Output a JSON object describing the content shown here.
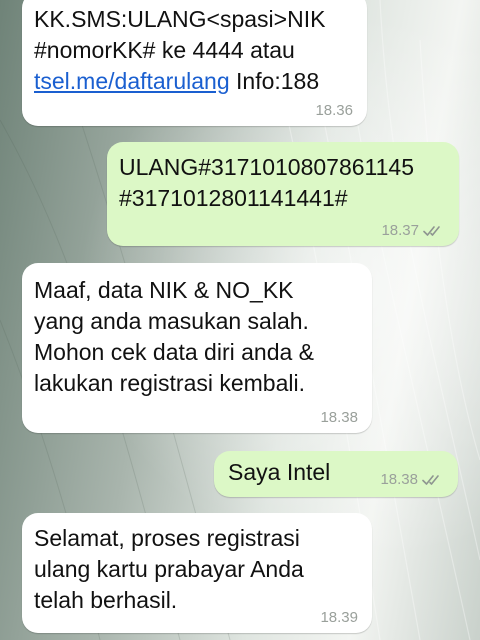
{
  "messages": [
    {
      "direction": "incoming",
      "text_prefix": "KK.SMS:ULANG<spasi>NIK\n#nomorKK# ke 4444 atau\n",
      "link": "tsel.me/daftarulang",
      "text_suffix": " Info:188",
      "time": "18.36"
    },
    {
      "direction": "outgoing",
      "text": "ULANG#3171010807861145\n#3171012801141441#",
      "time": "18.37",
      "status": "read"
    },
    {
      "direction": "incoming",
      "text": "Maaf, data NIK & NO_KK\nyang anda masukan salah.\nMohon cek data diri anda &\nlakukan registrasi kembali.",
      "time": "18.38"
    },
    {
      "direction": "outgoing",
      "text": "Saya Intel",
      "time": "18.38",
      "status": "read"
    },
    {
      "direction": "incoming",
      "text": "Selamat, proses registrasi\nulang kartu prabayar Anda\ntelah berhasil.",
      "time": "18.39"
    }
  ],
  "colors": {
    "incoming_bubble": "#ffffff",
    "outgoing_bubble": "#dcf8c6",
    "link": "#1a5fd0",
    "timestamp": "#9aa09b"
  },
  "icons": {
    "read_status": "double-check-icon"
  }
}
